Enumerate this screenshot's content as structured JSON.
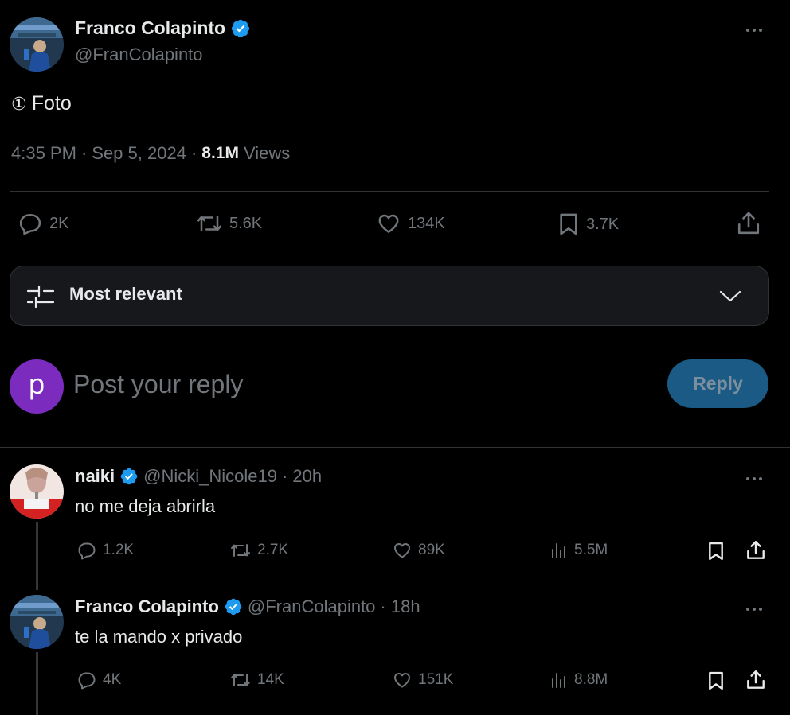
{
  "tweet": {
    "author_name": "Franco Colapinto",
    "author_handle": "@FranColapinto",
    "content_badge": "①",
    "content_text": "Foto",
    "time": "4:35 PM",
    "separator": "·",
    "date": "Sep 5, 2024",
    "views_count": "8.1M",
    "views_label": "Views",
    "stats": {
      "replies": "2K",
      "reposts": "5.6K",
      "likes": "134K",
      "bookmarks": "3.7K"
    }
  },
  "sort": {
    "label": "Most relevant"
  },
  "composer": {
    "avatar_letter": "p",
    "placeholder": "Post your reply",
    "reply_button": "Reply",
    "avatar_color": "#7b2cbf"
  },
  "replies": [
    {
      "name": "naiki",
      "handle": "@Nicki_Nicole19",
      "time": "· 20h",
      "text": "no me deja abrirla",
      "stats": {
        "replies": "1.2K",
        "reposts": "2.7K",
        "likes": "89K",
        "views": "5.5M"
      }
    },
    {
      "name": "Franco Colapinto",
      "handle": "@FranColapinto",
      "time": "· 18h",
      "text": "te la mando x privado",
      "stats": {
        "replies": "4K",
        "reposts": "14K",
        "likes": "151K",
        "views": "8.8M"
      }
    }
  ],
  "colors": {
    "background": "#000000",
    "accent": "#1d9bf0",
    "muted": "#71767b",
    "reply_button_bg": "#1a5a85"
  }
}
